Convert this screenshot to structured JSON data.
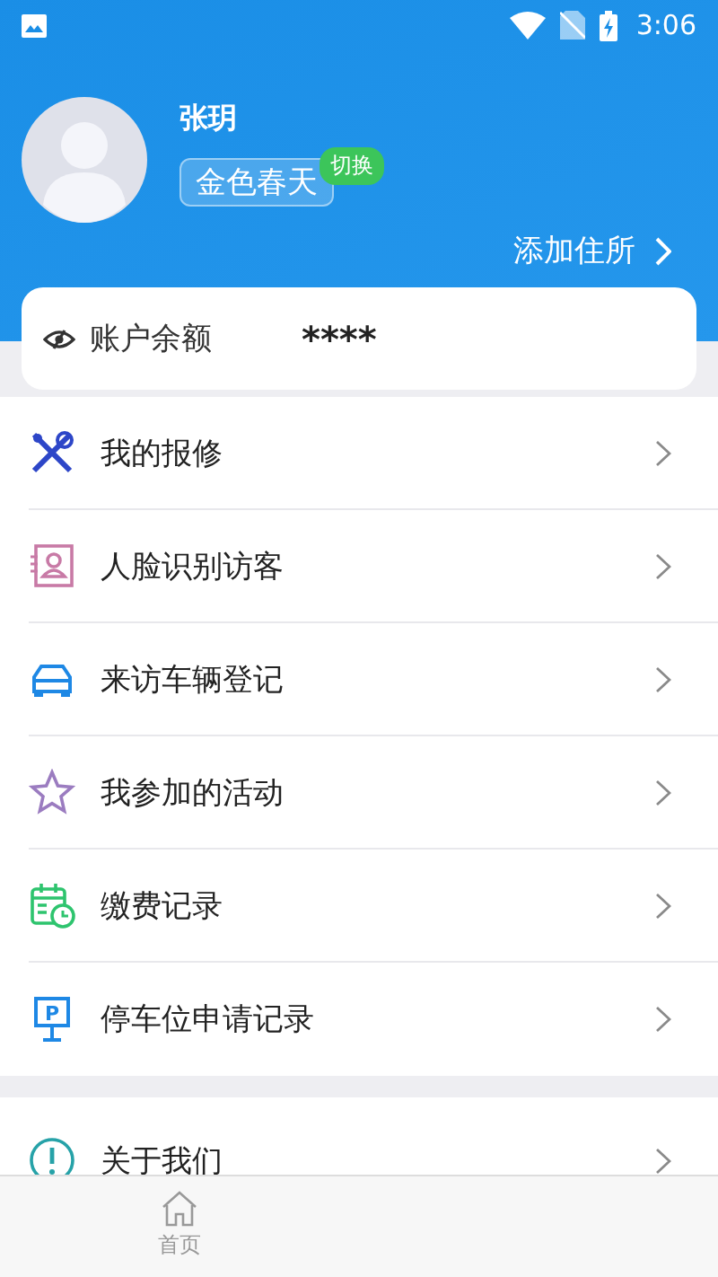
{
  "status_bar": {
    "time": "3:06"
  },
  "profile": {
    "name": "张玥",
    "community": "金色春天",
    "switch_badge": "切换",
    "add_address": "添加住所"
  },
  "balance": {
    "label": "账户余额",
    "value": "****"
  },
  "menu": [
    {
      "label": "我的报修"
    },
    {
      "label": "人脸识别访客"
    },
    {
      "label": "来访车辆登记"
    },
    {
      "label": "我参加的活动"
    },
    {
      "label": "缴费记录"
    },
    {
      "label": "停车位申请记录",
      "icon_letter": "P"
    }
  ],
  "menu_2": [
    {
      "label": "关于我们"
    }
  ],
  "tab_bar": [
    {
      "label": "首页",
      "selected": false
    }
  ]
}
